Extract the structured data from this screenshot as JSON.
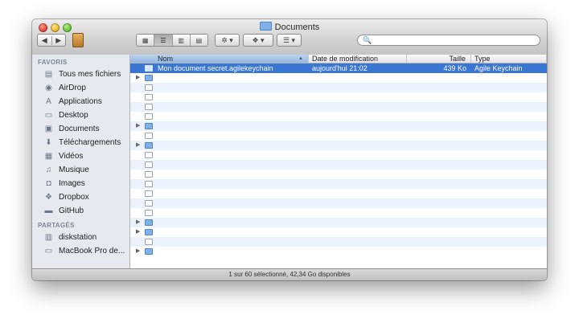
{
  "window": {
    "title": "Documents"
  },
  "toolbar": {
    "back": "◀",
    "forward": "▶",
    "search_placeholder": "🔍"
  },
  "sidebar": {
    "favorites_label": "FAVORIS",
    "favorites": [
      {
        "label": "Tous mes fichiers",
        "icon": "all-files-icon",
        "glyph": "▤"
      },
      {
        "label": "AirDrop",
        "icon": "airdrop-icon",
        "glyph": "◉"
      },
      {
        "label": "Applications",
        "icon": "applications-icon",
        "glyph": "A"
      },
      {
        "label": "Desktop",
        "icon": "desktop-icon",
        "glyph": "▭"
      },
      {
        "label": "Documents",
        "icon": "documents-icon",
        "glyph": "▣"
      },
      {
        "label": "Téléchargements",
        "icon": "downloads-icon",
        "glyph": "⬇"
      },
      {
        "label": "Vidéos",
        "icon": "movies-icon",
        "glyph": "▦"
      },
      {
        "label": "Musique",
        "icon": "music-icon",
        "glyph": "♫"
      },
      {
        "label": "Images",
        "icon": "pictures-icon",
        "glyph": "◘"
      },
      {
        "label": "Dropbox",
        "icon": "dropbox-icon",
        "glyph": "❖"
      },
      {
        "label": "GitHub",
        "icon": "folder-icon",
        "glyph": "▬"
      }
    ],
    "shared_label": "PARTAGÉS",
    "shared": [
      {
        "label": "diskstation",
        "icon": "server-icon",
        "glyph": "▥"
      },
      {
        "label": "MacBook Pro de...",
        "icon": "laptop-icon",
        "glyph": "▭"
      }
    ]
  },
  "columns": {
    "name": "Nom",
    "date": "Date de modification",
    "size": "Taille",
    "type": "Type"
  },
  "rows": [
    {
      "name": "Mon document secret.agilekeychain",
      "date": "aujourd'hui 21:02",
      "size": "439 Ko",
      "type": "Agile Keychain",
      "selected": true,
      "folder": false,
      "icon": "kc"
    },
    {
      "name": "",
      "date": "",
      "size": "",
      "type": "",
      "folder": true,
      "icon": "folder"
    },
    {
      "name": "",
      "date": "",
      "size": "",
      "type": "",
      "folder": false,
      "icon": "file"
    },
    {
      "name": "",
      "date": "",
      "size": "",
      "type": "",
      "folder": false,
      "icon": "file"
    },
    {
      "name": "",
      "date": "",
      "size": "",
      "type": "",
      "folder": false,
      "icon": "file"
    },
    {
      "name": "",
      "date": "",
      "size": "",
      "type": "",
      "folder": false,
      "icon": "file"
    },
    {
      "name": "",
      "date": "",
      "size": "",
      "type": "",
      "folder": true,
      "icon": "folder"
    },
    {
      "name": "",
      "date": "",
      "size": "",
      "type": "",
      "folder": false,
      "icon": "file"
    },
    {
      "name": "",
      "date": "",
      "size": "",
      "type": "",
      "folder": true,
      "icon": "folder"
    },
    {
      "name": "",
      "date": "",
      "size": "",
      "type": "",
      "folder": false,
      "icon": "file"
    },
    {
      "name": "",
      "date": "",
      "size": "",
      "type": "",
      "folder": false,
      "icon": "file"
    },
    {
      "name": "",
      "date": "",
      "size": "",
      "type": "",
      "folder": false,
      "icon": "file"
    },
    {
      "name": "",
      "date": "",
      "size": "",
      "type": "",
      "folder": false,
      "icon": "file"
    },
    {
      "name": "",
      "date": "",
      "size": "",
      "type": "",
      "folder": false,
      "icon": "file"
    },
    {
      "name": "",
      "date": "",
      "size": "",
      "type": "",
      "folder": false,
      "icon": "file"
    },
    {
      "name": "",
      "date": "",
      "size": "",
      "type": "",
      "folder": false,
      "icon": "file"
    },
    {
      "name": "",
      "date": "",
      "size": "",
      "type": "",
      "folder": true,
      "icon": "folder"
    },
    {
      "name": "",
      "date": "",
      "size": "",
      "type": "",
      "folder": true,
      "icon": "folder"
    },
    {
      "name": "",
      "date": "",
      "size": "",
      "type": "",
      "folder": false,
      "icon": "file"
    },
    {
      "name": "",
      "date": "",
      "size": "",
      "type": "",
      "folder": true,
      "icon": "folder"
    }
  ],
  "status": {
    "text": "1 sur 60 sélectionné, 42,34 Go disponibles"
  },
  "colors": {
    "selection": "#3a76d3",
    "sidebar_bg": "#e6eaf0"
  }
}
